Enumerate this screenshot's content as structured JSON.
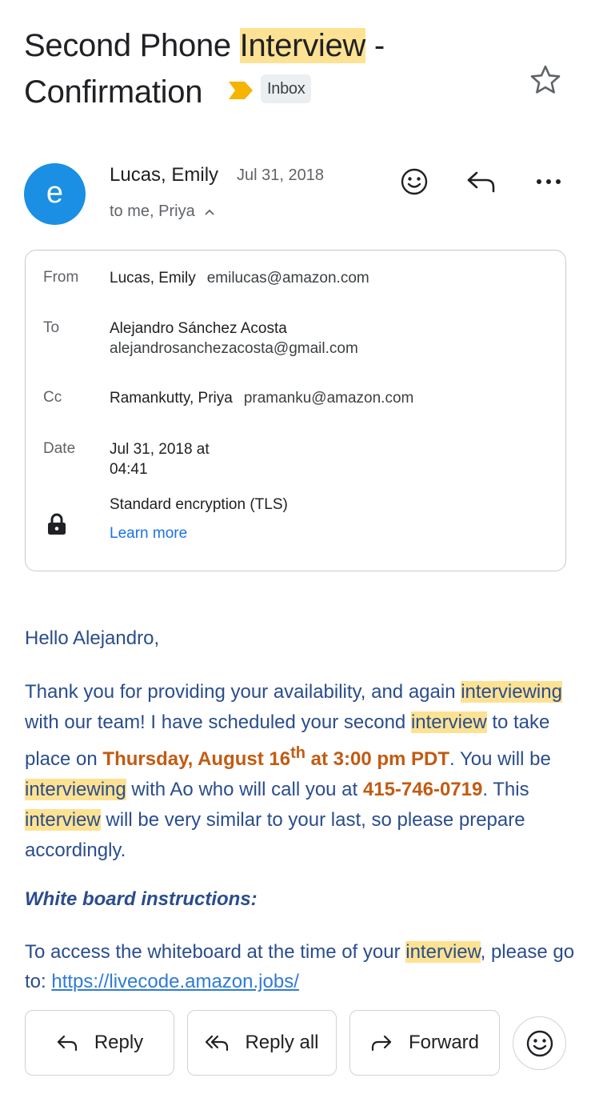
{
  "subject": {
    "part1": "Second Phone ",
    "highlight": "Interview",
    "part2": " - Confirmation",
    "label_chip": "Inbox"
  },
  "sender": {
    "avatar_letter": "e",
    "name": "Lucas, Emily",
    "date": "Jul 31, 2018",
    "to_line": "to me, Priya"
  },
  "details": {
    "from_label": "From",
    "from_name": "Lucas, Emily",
    "from_email": "emilucas@amazon.com",
    "to_label": "To",
    "to_name": "Alejandro Sánchez Acosta",
    "to_email": "alejandrosanchezacosta@gmail.com",
    "cc_label": "Cc",
    "cc_name": "Ramankutty, Priya",
    "cc_email": "pramanku@amazon.com",
    "date_label": "Date",
    "date_line1": "Jul 31, 2018 at",
    "date_line2": "04:41",
    "encryption": "Standard encryption (TLS)",
    "learn_more": "Learn more"
  },
  "body": {
    "greeting": "Hello Alejandro,",
    "p1_a": "Thank you for providing your availability, and again ",
    "p1_hl1": "interviewing",
    "p1_b": " with our team! I have scheduled your second ",
    "p1_hl2": "interview",
    "p1_c": " to take place on ",
    "p1_date": "Thursday, August 16",
    "p1_date_sup": "th",
    "p1_time": " at 3:00 pm PDT",
    "p1_d": ". You will be ",
    "p1_hl3": "interviewing",
    "p1_e": " with Ao who will call you at ",
    "p1_phone": "415-746-0719",
    "p1_f": ". This ",
    "p1_hl4": "interview",
    "p1_g": " will be very similar to your last, so please prepare accordingly.",
    "wb_title": "White board instructions:",
    "p2_a": "To access the whiteboard at the time of your ",
    "p2_hl": "interview",
    "p2_b": ", please go to: ",
    "p2_link": "https://livecode.amazon.jobs/"
  },
  "actions": {
    "reply": "Reply",
    "reply_all": "Reply all",
    "forward": "Forward"
  },
  "colors": {
    "highlight": "#fde293",
    "avatar": "#1a8fe3",
    "body_text": "#2a4d8c",
    "emphasis": "#c25b12",
    "link": "#1a73e8",
    "important_marker": "#f4b400"
  }
}
